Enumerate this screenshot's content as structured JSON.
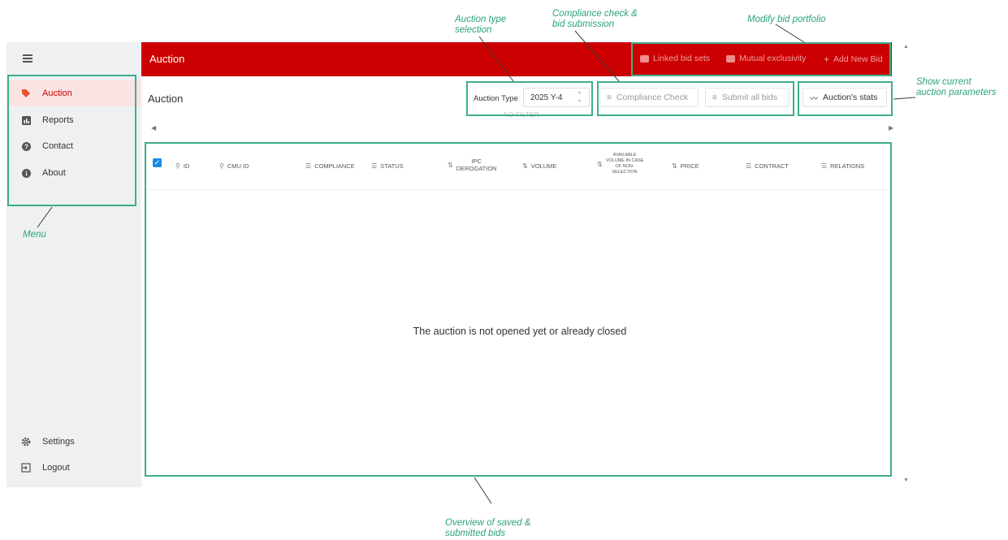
{
  "sidebar": {
    "items": [
      {
        "label": "Auction",
        "icon": "tag-icon"
      },
      {
        "label": "Reports",
        "icon": "bar-chart-icon"
      },
      {
        "label": "Contact",
        "icon": "help-icon"
      },
      {
        "label": "About",
        "icon": "info-icon"
      }
    ],
    "bottom": [
      {
        "label": "Settings",
        "icon": "gear-icon"
      },
      {
        "label": "Logout",
        "icon": "logout-icon"
      }
    ]
  },
  "header": {
    "title": "Auction",
    "actions": {
      "linked": "Linked bid sets",
      "mutual": "Mutual exclusivity",
      "add": "Add New Bid"
    }
  },
  "page": {
    "title": "Auction",
    "auction_type_label": "Auction Type",
    "auction_type_value": "2025 Y-4",
    "compliance_button": "Compliance Check",
    "submit_button": "Submit all bids",
    "stats_button": "Auction's stats",
    "no_filter": "NO FILTER"
  },
  "table": {
    "columns": {
      "id": "ID",
      "cmu": "CMU ID",
      "compliance": "COMPLIANCE",
      "status": "STATUS",
      "ipc1": "IPC",
      "ipc2": "DEROGATION",
      "volume": "VOLUME",
      "avail1": "AVAILABLE",
      "avail2": "VOLUME IN CASE",
      "avail3": "OF NON-",
      "avail4": "SELECTION",
      "price": "PRICE",
      "contract": "CONTRACT",
      "relations": "RELATIONS"
    },
    "empty_message": "The auction is not opened yet or already closed"
  },
  "annotations": {
    "auction_type_1": "Auction type",
    "auction_type_2": "selection",
    "compliance_1": "Compliance check &",
    "compliance_2": "bid submission",
    "modify": "Modify bid portfolio",
    "stats_1": "Show current",
    "stats_2": "auction parameters",
    "menu": "Menu",
    "overview_1": "Overview of saved &",
    "overview_2": "submitted bids"
  },
  "colors": {
    "brand_red": "#cc0000",
    "annotation_green": "#3fae8a",
    "checkbox_blue": "#1e88e5"
  }
}
